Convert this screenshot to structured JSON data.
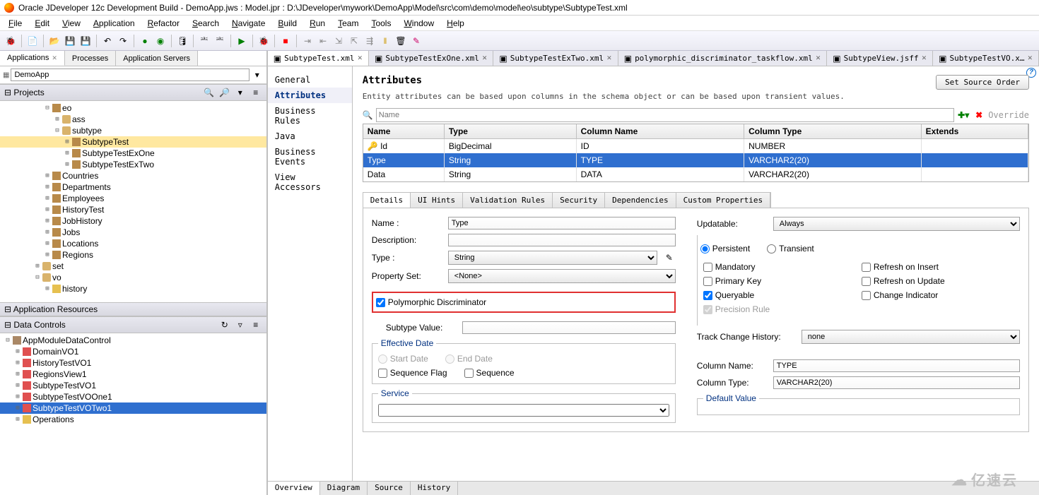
{
  "title": "Oracle JDeveloper 12c Development Build - DemoApp.jws : Model.jpr : D:\\JDeveloper\\mywork\\DemoApp\\Model\\src\\com\\demo\\model\\eo\\subtype\\SubtypeTest.xml",
  "menu": [
    "File",
    "Edit",
    "View",
    "Application",
    "Refactor",
    "Search",
    "Navigate",
    "Build",
    "Run",
    "Team",
    "Tools",
    "Window",
    "Help"
  ],
  "left_tabs": [
    "Applications",
    "Processes",
    "Application Servers"
  ],
  "app_combo": "DemoApp",
  "projects_label": "Projects",
  "project_tree": [
    {
      "d": 4,
      "e": "-",
      "i": "eo",
      "t": "eo"
    },
    {
      "d": 5,
      "e": "+",
      "i": "pkg",
      "t": "ass"
    },
    {
      "d": 5,
      "e": "-",
      "i": "pkg",
      "t": "subtype"
    },
    {
      "d": 6,
      "e": "+",
      "i": "eo",
      "t": "SubtypeTest",
      "sel": true
    },
    {
      "d": 6,
      "e": "+",
      "i": "eo",
      "t": "SubtypeTestExOne"
    },
    {
      "d": 6,
      "e": "+",
      "i": "eo",
      "t": "SubtypeTestExTwo"
    },
    {
      "d": 4,
      "e": "+",
      "i": "eo",
      "t": "Countries"
    },
    {
      "d": 4,
      "e": "+",
      "i": "eo",
      "t": "Departments"
    },
    {
      "d": 4,
      "e": "+",
      "i": "eo",
      "t": "Employees"
    },
    {
      "d": 4,
      "e": "+",
      "i": "eo",
      "t": "HistoryTest"
    },
    {
      "d": 4,
      "e": "+",
      "i": "eo",
      "t": "JobHistory"
    },
    {
      "d": 4,
      "e": "+",
      "i": "eo",
      "t": "Jobs"
    },
    {
      "d": 4,
      "e": "+",
      "i": "eo",
      "t": "Locations"
    },
    {
      "d": 4,
      "e": "+",
      "i": "eo",
      "t": "Regions"
    },
    {
      "d": 3,
      "e": "+",
      "i": "pkg",
      "t": "set"
    },
    {
      "d": 3,
      "e": "-",
      "i": "pkg",
      "t": "vo"
    },
    {
      "d": 4,
      "e": "+",
      "i": "folder",
      "t": "history"
    }
  ],
  "app_res_label": "Application Resources",
  "data_controls_label": "Data Controls",
  "data_controls": [
    {
      "d": 0,
      "e": "-",
      "i": "am",
      "t": "AppModuleDataControl"
    },
    {
      "d": 1,
      "e": "+",
      "i": "vo",
      "t": "DomainVO1"
    },
    {
      "d": 1,
      "e": "+",
      "i": "vo",
      "t": "HistoryTestVO1"
    },
    {
      "d": 1,
      "e": "+",
      "i": "vo",
      "t": "RegionsView1"
    },
    {
      "d": 1,
      "e": "+",
      "i": "vo",
      "t": "SubtypeTestVO1"
    },
    {
      "d": 1,
      "e": "+",
      "i": "vo",
      "t": "SubtypeTestVOOne1"
    },
    {
      "d": 1,
      "e": "+",
      "i": "vo",
      "t": "SubtypeTestVOTwo1",
      "selblue": true
    },
    {
      "d": 1,
      "e": "+",
      "i": "folder",
      "t": "Operations"
    }
  ],
  "editor_tabs": [
    {
      "label": "SubtypeTest.xml",
      "active": true
    },
    {
      "label": "SubtypeTestExOne.xml"
    },
    {
      "label": "SubtypeTestExTwo.xml"
    },
    {
      "label": "polymorphic_discriminator_taskflow.xml"
    },
    {
      "label": "SubtypeView.jsff"
    },
    {
      "label": "SubtypeTestVO.x…"
    }
  ],
  "side_nav": [
    "General",
    "Attributes",
    "Business Rules",
    "Java",
    "Business Events",
    "View Accessors"
  ],
  "side_nav_active": "Attributes",
  "heading": "Attributes",
  "set_order": "Set Source Order",
  "desc": "Entity attributes can be based upon columns in the schema object or can be based upon transient values.",
  "search_placeholder": "Name",
  "override_label": "Override",
  "attr_cols": [
    "Name",
    "Type",
    "Column Name",
    "Column Type",
    "Extends"
  ],
  "attr_rows": [
    {
      "key": true,
      "c": [
        "Id",
        "BigDecimal",
        "ID",
        "NUMBER",
        ""
      ]
    },
    {
      "sel": true,
      "c": [
        "Type",
        "String",
        "TYPE",
        "VARCHAR2(20)",
        ""
      ]
    },
    {
      "c": [
        "Data",
        "String",
        "DATA",
        "VARCHAR2(20)",
        ""
      ]
    }
  ],
  "detail_tabs": [
    "Details",
    "UI Hints",
    "Validation Rules",
    "Security",
    "Dependencies",
    "Custom Properties"
  ],
  "details": {
    "name_lbl": "Name :",
    "name_val": "Type",
    "desc_lbl": "Description:",
    "desc_val": "",
    "type_lbl": "Type :",
    "type_val": "String",
    "pset_lbl": "Property Set:",
    "pset_val": "<None>",
    "poly_lbl": "Polymorphic Discriminator",
    "poly_checked": true,
    "subval_lbl": "Subtype Value:",
    "subval_val": "",
    "eff_lbl": "Effective Date",
    "start_lbl": "Start Date",
    "end_lbl": "End Date",
    "seqflag_lbl": "Sequence Flag",
    "seq_lbl": "Sequence",
    "svc_lbl": "Service",
    "upd_lbl": "Updatable:",
    "upd_val": "Always",
    "persist": "Persistent",
    "transient": "Transient",
    "mandatory": "Mandatory",
    "refresh_ins": "Refresh on Insert",
    "pk": "Primary Key",
    "refresh_upd": "Refresh on Update",
    "queryable": "Queryable",
    "chg_ind": "Change Indicator",
    "precision": "Precision Rule",
    "track_lbl": "Track Change History:",
    "track_val": "none",
    "colname_lbl": "Column Name:",
    "colname_val": "TYPE",
    "coltype_lbl": "Column Type:",
    "coltype_val": "VARCHAR2(20)",
    "defval_lbl": "Default Value"
  },
  "bottom_tabs": [
    "Overview",
    "Diagram",
    "Source",
    "History"
  ],
  "watermark": "亿速云"
}
